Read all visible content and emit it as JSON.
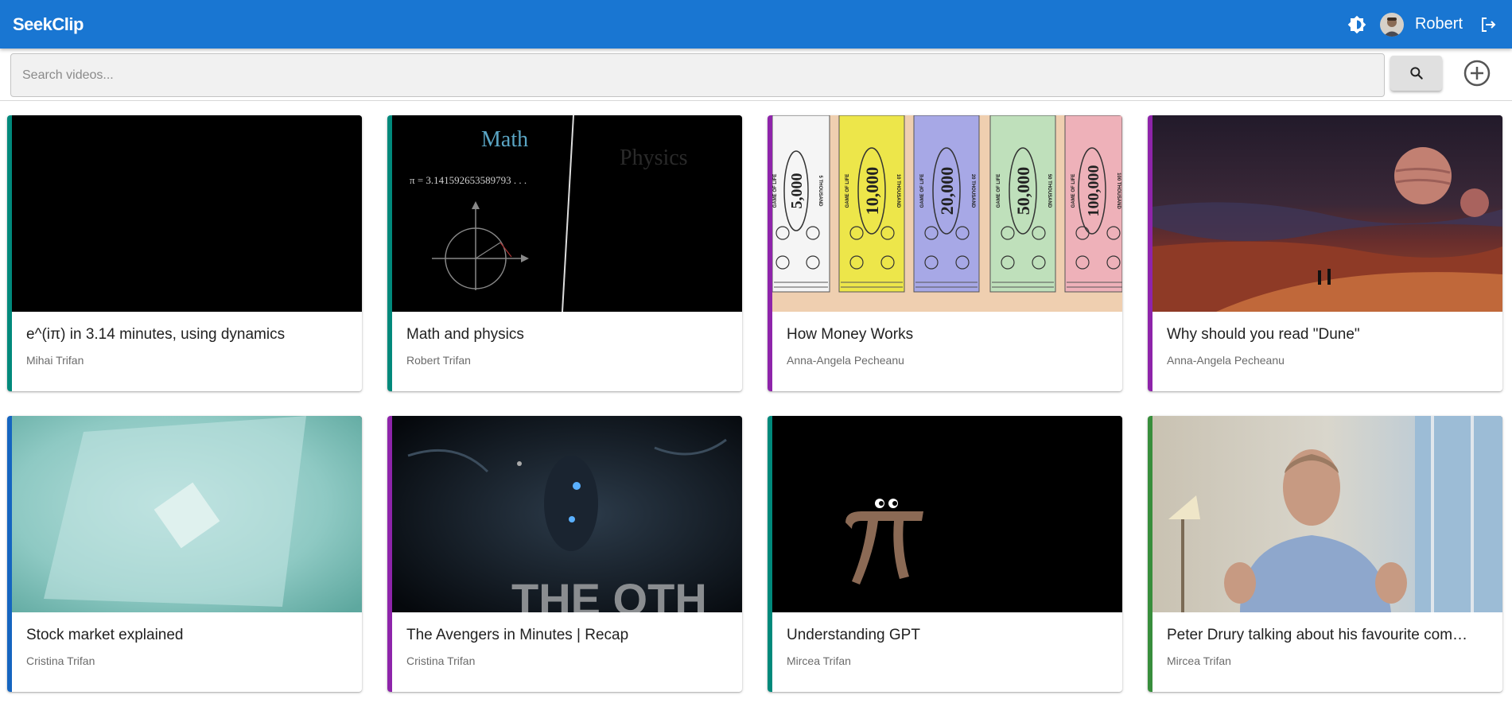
{
  "app": {
    "logo": "SeekClip"
  },
  "user": {
    "name": "Robert"
  },
  "search": {
    "placeholder": "Search videos...",
    "value": ""
  },
  "colors": {
    "appbar": "#1976d2",
    "teal": "#00897b",
    "purple": "#8e24aa",
    "blue": "#1565c0",
    "green": "#388e3c"
  },
  "videos": [
    {
      "title": "e^(iπ) in 3.14 minutes, using dynamics",
      "author": "Mihai Trifan",
      "accent": "#00897b"
    },
    {
      "title": "Math and physics",
      "author": "Robert Trifan",
      "accent": "#00897b",
      "thumb_text": {
        "left": "Math",
        "right": "Physics",
        "formula": "π = 3.1415926535897­93 . . ."
      }
    },
    {
      "title": "How Money Works",
      "author": "Anna-Angela Pecheanu",
      "accent": "#8e24aa",
      "thumb_text": {
        "bills": [
          "5,000",
          "10,000",
          "20,000",
          "50,000",
          "100,000"
        ],
        "side_top": "GAME OF LIFE",
        "side_bottom": [
          "5 THOUSAND",
          "10 THOUSAND",
          "20 THOUSAND",
          "50 THOUSAND",
          "100 THOUSAND"
        ]
      }
    },
    {
      "title": "Why should you read \"Dune\"",
      "author": "Anna-Angela Pecheanu",
      "accent": "#8e24aa"
    },
    {
      "title": "Stock market explained",
      "author": "Cristina Trifan",
      "accent": "#1565c0"
    },
    {
      "title": "The Avengers in Minutes | Recap",
      "author": "Cristina Trifan",
      "accent": "#8e24aa",
      "thumb_text": {
        "banner": "THE OTH"
      }
    },
    {
      "title": "Understanding GPT",
      "author": "Mircea Trifan",
      "accent": "#00897b"
    },
    {
      "title": "Peter Drury talking about his favourite com…",
      "author": "Mircea Trifan",
      "accent": "#388e3c"
    }
  ]
}
